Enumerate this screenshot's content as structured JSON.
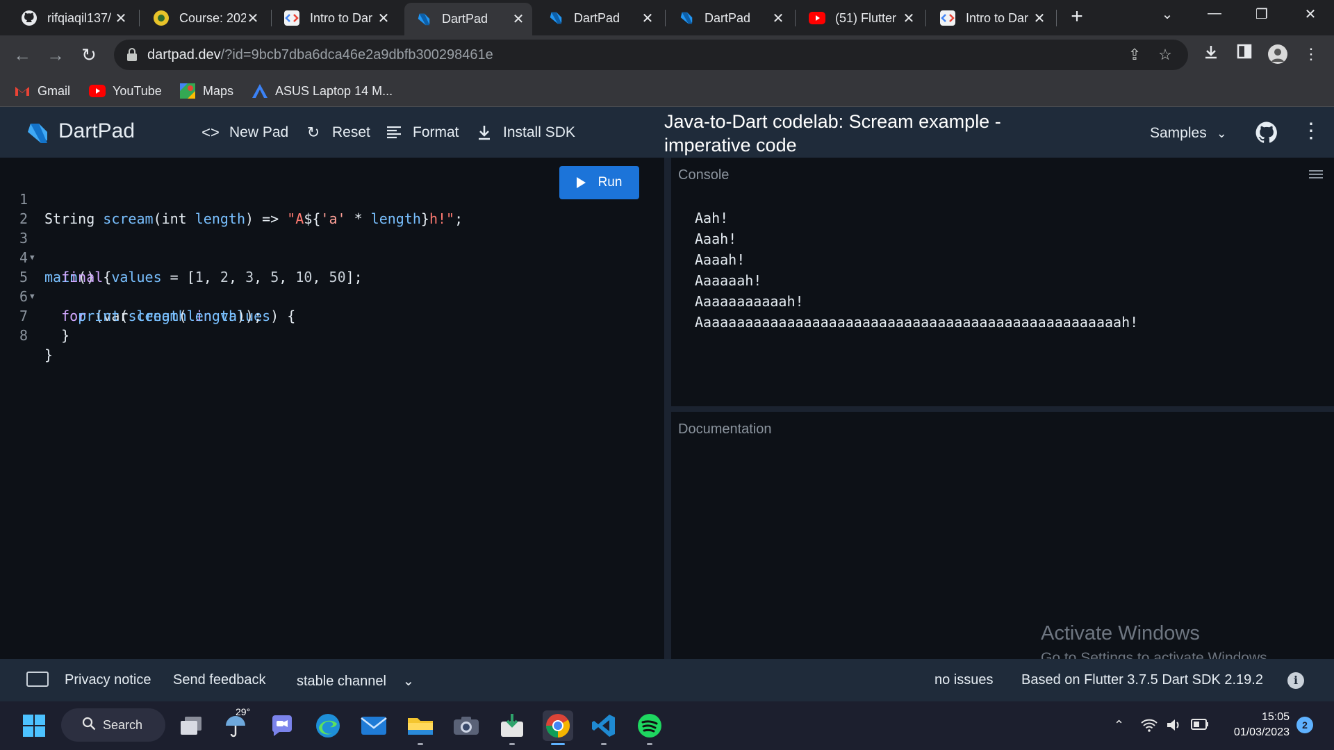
{
  "browser": {
    "tabs": [
      {
        "title": "rifqiaqil137/",
        "icon": "github-icon",
        "active": false
      },
      {
        "title": "Course: 202",
        "icon": "course-icon",
        "active": false
      },
      {
        "title": "Intro to Dar",
        "icon": "codelab-icon",
        "active": false
      },
      {
        "title": "DartPad",
        "icon": "dart-icon",
        "active": true
      },
      {
        "title": "DartPad",
        "icon": "dart-icon",
        "active": false
      },
      {
        "title": "DartPad",
        "icon": "dart-icon",
        "active": false
      },
      {
        "title": "(51) Flutter",
        "icon": "youtube-icon",
        "active": false
      },
      {
        "title": "Intro to Dar",
        "icon": "codelab-icon",
        "active": false
      }
    ],
    "url_host": "dartpad.dev",
    "url_path": "/?id=9bcb7dba6dca46e2a9dbfb300298461e",
    "bookmarks": [
      {
        "label": "Gmail",
        "icon": "gmail-icon"
      },
      {
        "label": "YouTube",
        "icon": "youtube-icon"
      },
      {
        "label": "Maps",
        "icon": "maps-icon"
      },
      {
        "label": "ASUS Laptop 14 M...",
        "icon": "asus-icon"
      }
    ]
  },
  "dartpad": {
    "app_name": "DartPad",
    "actions": [
      {
        "label": "New Pad",
        "icon": "code-brackets-icon"
      },
      {
        "label": "Reset",
        "icon": "refresh-icon"
      },
      {
        "label": "Format",
        "icon": "format-lines-icon"
      },
      {
        "label": "Install SDK",
        "icon": "download-icon"
      }
    ],
    "pad_title": "Java-to-Dart codelab: Scream example - imperative code",
    "samples_label": "Samples",
    "run_label": "Run",
    "code_lines": [
      {
        "n": "1",
        "text": "String scream(int length) => \"A${'a' * length}h!\";"
      },
      {
        "n": "2",
        "text": ""
      },
      {
        "n": "3",
        "text": "main() {"
      },
      {
        "n": "4",
        "text": "  final values = [1, 2, 3, 5, 10, 50];"
      },
      {
        "n": "5",
        "text": "  for (var length in values) {"
      },
      {
        "n": "6",
        "text": "    print(scream(length));"
      },
      {
        "n": "7",
        "text": "  }"
      },
      {
        "n": "8",
        "text": "}"
      }
    ],
    "console_label": "Console",
    "console_output": [
      "Aah!",
      "Aaah!",
      "Aaaah!",
      "Aaaaaah!",
      "Aaaaaaaaaaah!",
      "Aaaaaaaaaaaaaaaaaaaaaaaaaaaaaaaaaaaaaaaaaaaaaaaaaaah!"
    ],
    "docs_label": "Documentation",
    "footer": {
      "privacy": "Privacy notice",
      "feedback": "Send feedback",
      "channel": "stable channel",
      "issues": "no issues",
      "version": "Based on Flutter 3.7.5 Dart SDK 2.19.2"
    }
  },
  "watermark": {
    "title": "Activate Windows",
    "subtitle": "Go to Settings to activate Windows."
  },
  "taskbar": {
    "search_label": "Search",
    "weather": "29°",
    "time": "15:05",
    "date": "01/03/2023",
    "notifications": "2"
  },
  "colors": {
    "accent": "#1c74d9",
    "header_bg": "#1f2b3a",
    "editor_bg": "#0d1117"
  }
}
